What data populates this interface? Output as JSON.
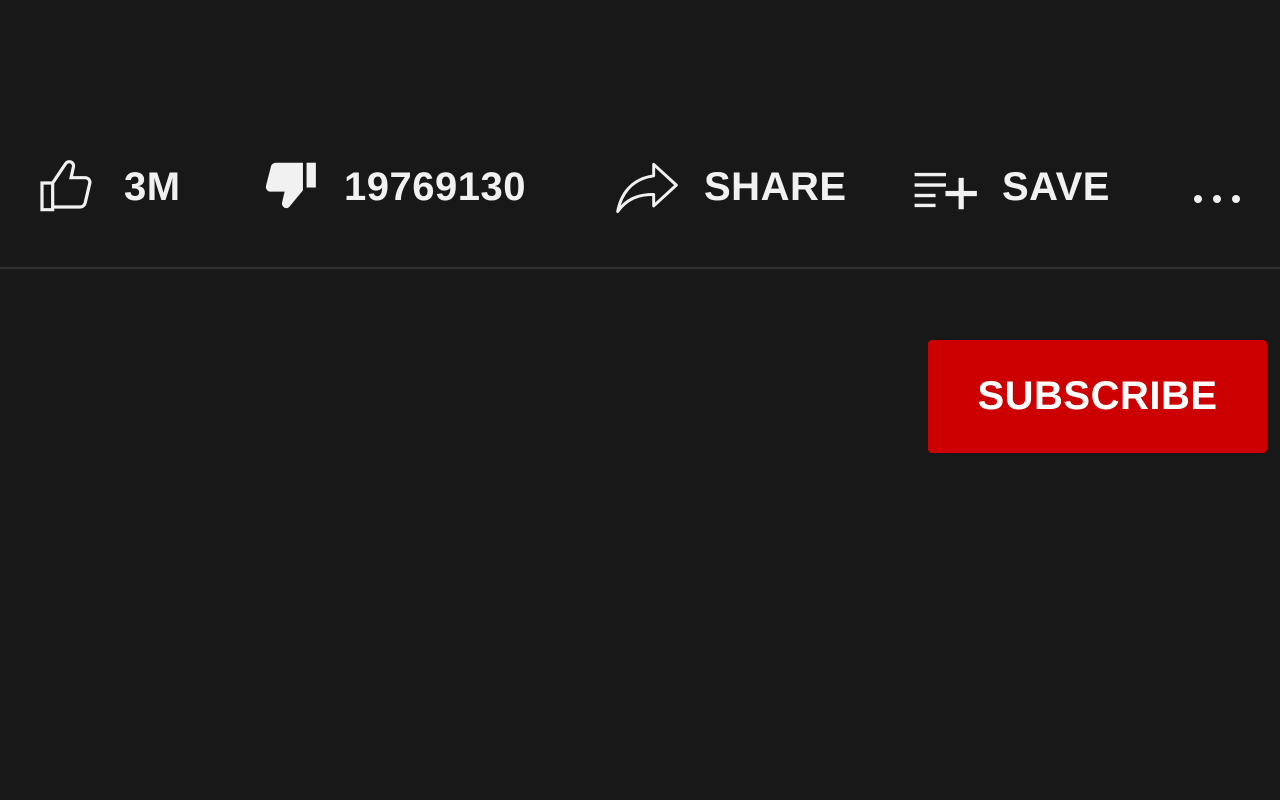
{
  "actions": {
    "like": {
      "count": "3M",
      "icon": "thumbs-up-icon"
    },
    "dislike": {
      "count": "19769130",
      "icon": "thumbs-down-icon"
    },
    "share": {
      "label": "SHARE",
      "icon": "share-arrow-icon"
    },
    "save": {
      "label": "SAVE",
      "icon": "playlist-add-icon"
    },
    "more": {
      "icon": "more-horizontal-icon"
    }
  },
  "subscribe": {
    "label": "SUBSCRIBE"
  },
  "colors": {
    "background": "#181818",
    "text": "#f1f1f1",
    "divider": "#303030",
    "subscribe": "#cc0000"
  }
}
